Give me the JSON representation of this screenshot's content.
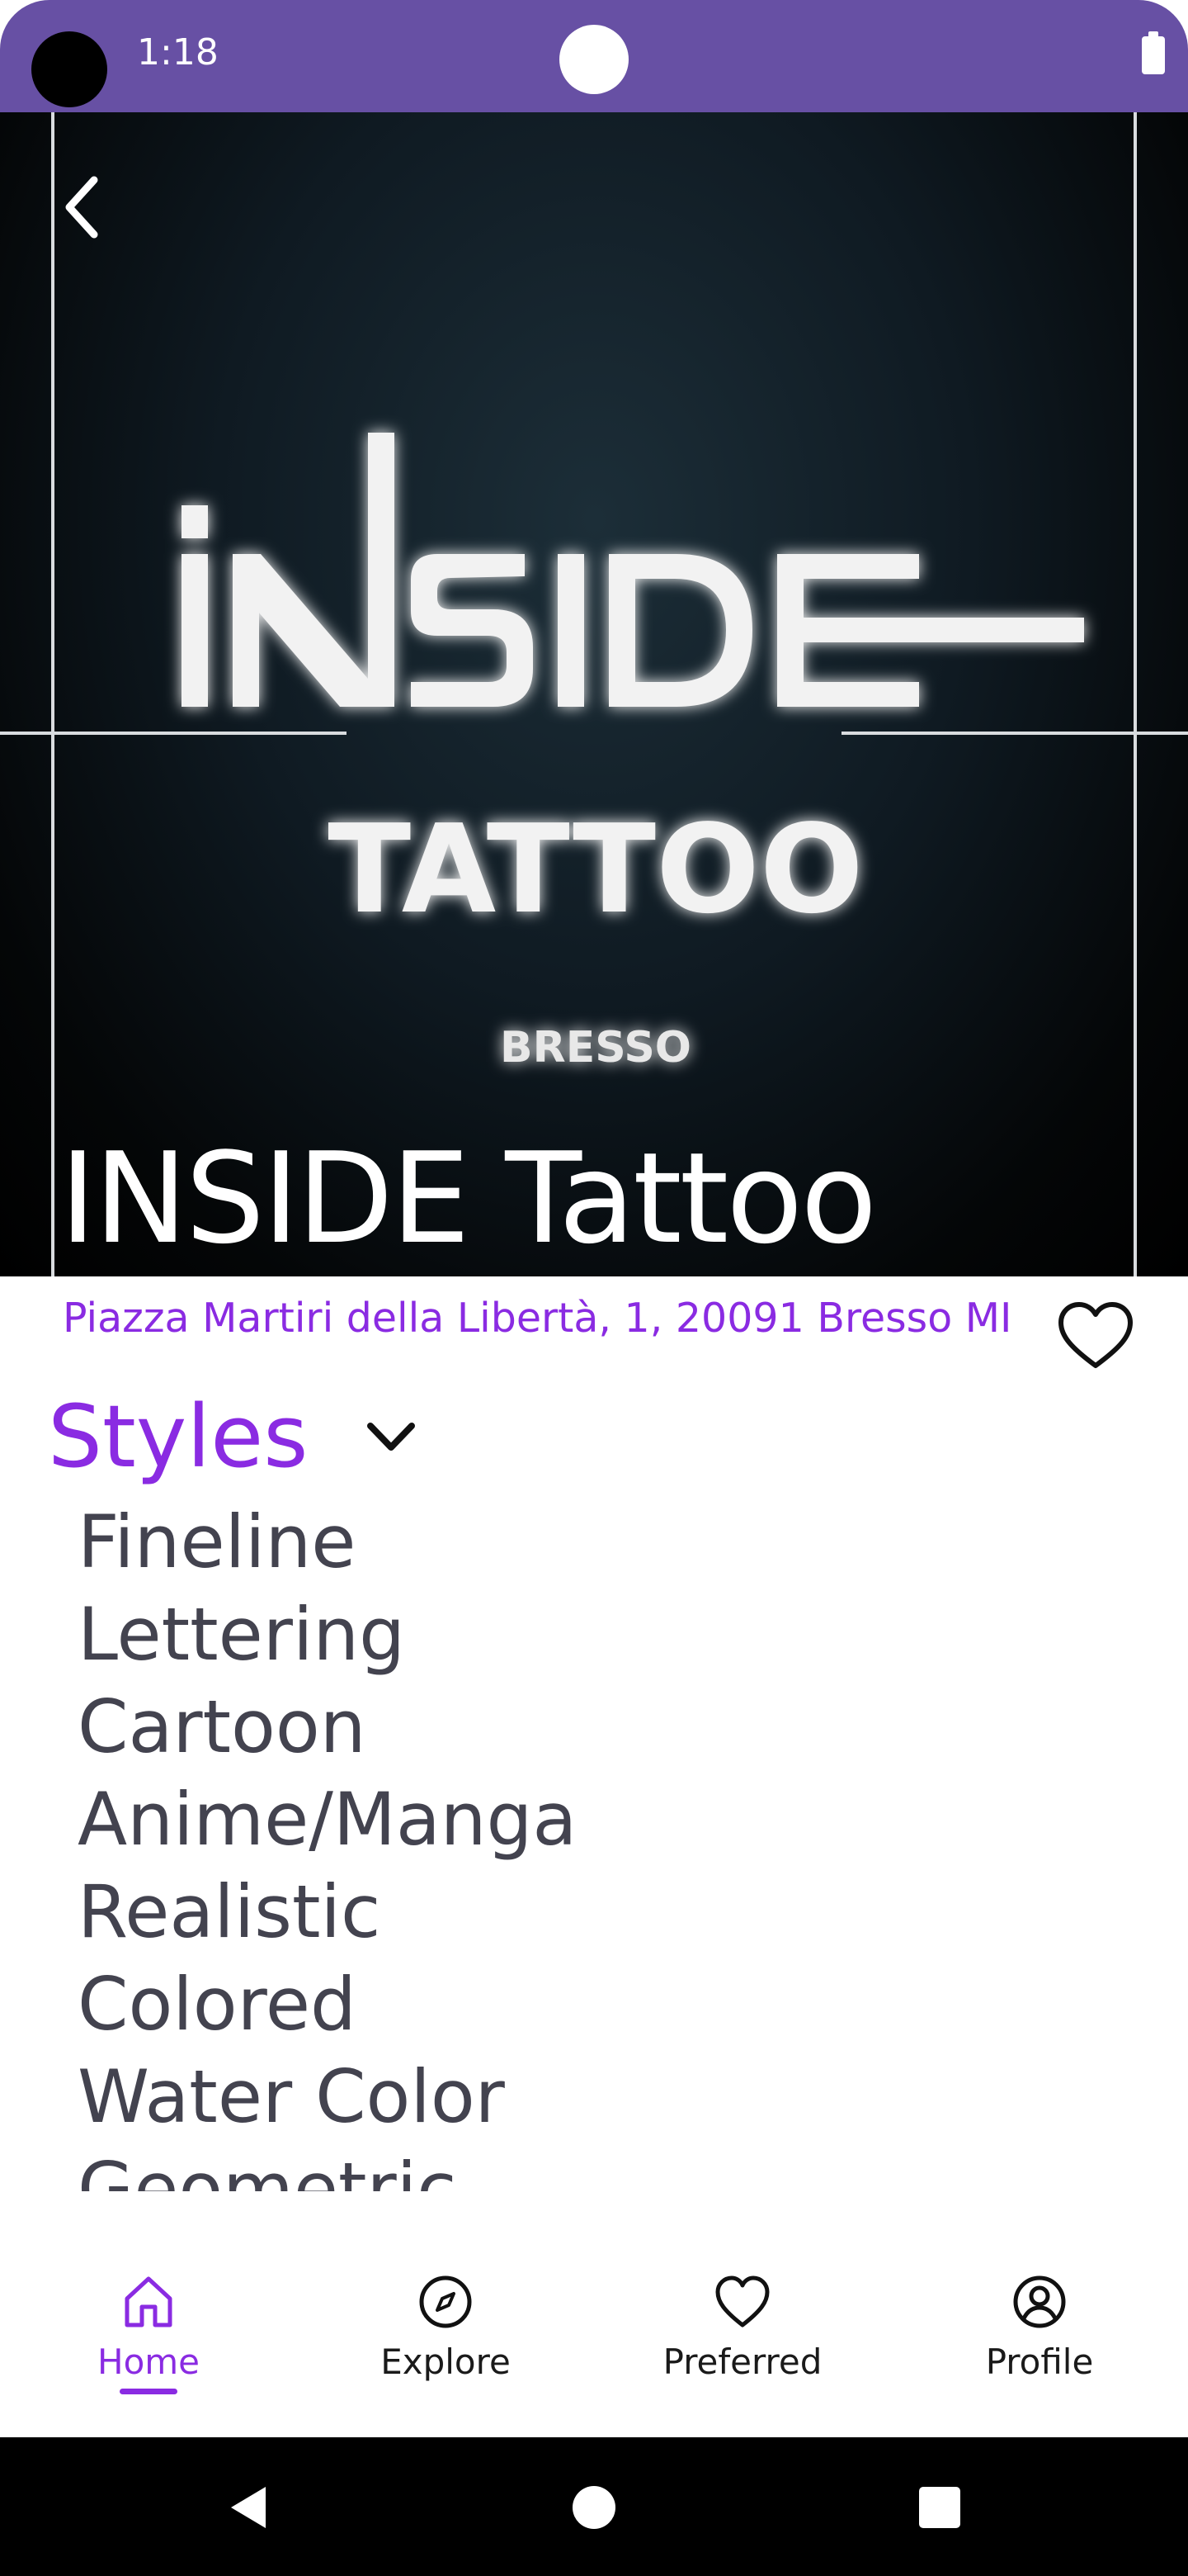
{
  "status_bar": {
    "time": "1:18",
    "color": "#6750a4"
  },
  "hero": {
    "title": "INSIDE Tattoo",
    "logo_text": {
      "line1": "INSIDE",
      "line2": "TATTOO",
      "line3": "BRESSO"
    }
  },
  "shop": {
    "address": "Piazza Martiri della Libertà, 1, 20091 Bresso MI"
  },
  "styles": {
    "title": "Styles",
    "items": [
      "Fineline",
      "Lettering",
      "Cartoon",
      "Anime/Manga",
      "Realistic",
      "Colored",
      "Water Color",
      "Geometric"
    ]
  },
  "bottom_nav": {
    "items": [
      {
        "label": "Home",
        "icon": "home-icon",
        "active": true
      },
      {
        "label": "Explore",
        "icon": "compass-icon",
        "active": false
      },
      {
        "label": "Preferred",
        "icon": "heart-icon",
        "active": false
      },
      {
        "label": "Profile",
        "icon": "user-circle-icon",
        "active": false
      }
    ]
  },
  "colors": {
    "accent": "#8a2be2",
    "text_dark": "#43434f",
    "status_bar": "#6750a4"
  }
}
